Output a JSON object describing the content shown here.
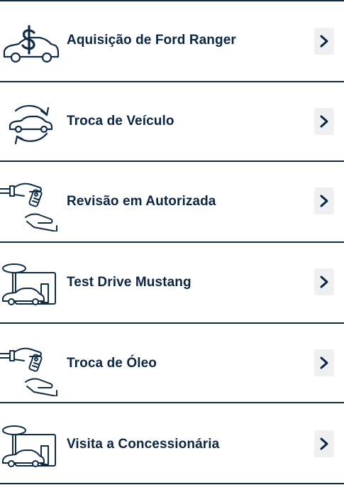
{
  "items": [
    {
      "label": "Aquisição de Ford Ranger",
      "icon": "car-dollar-icon"
    },
    {
      "label": "Troca de Veículo",
      "icon": "car-exchange-icon"
    },
    {
      "label": "Revisão em Autorizada",
      "icon": "hand-key-icon"
    },
    {
      "label": "Test Drive Mustang",
      "icon": "car-dealership-icon"
    },
    {
      "label": "Troca de Óleo",
      "icon": "hand-key-icon"
    },
    {
      "label": "Visita a Concessionária",
      "icon": "car-dealership-icon"
    }
  ],
  "chevron_icon": "chevron-right-icon",
  "colors": {
    "text": "#0b2545",
    "icon_stroke": "#0f2b46",
    "chevron_bg": "#eef0f2",
    "divider": "#0f2b46"
  }
}
